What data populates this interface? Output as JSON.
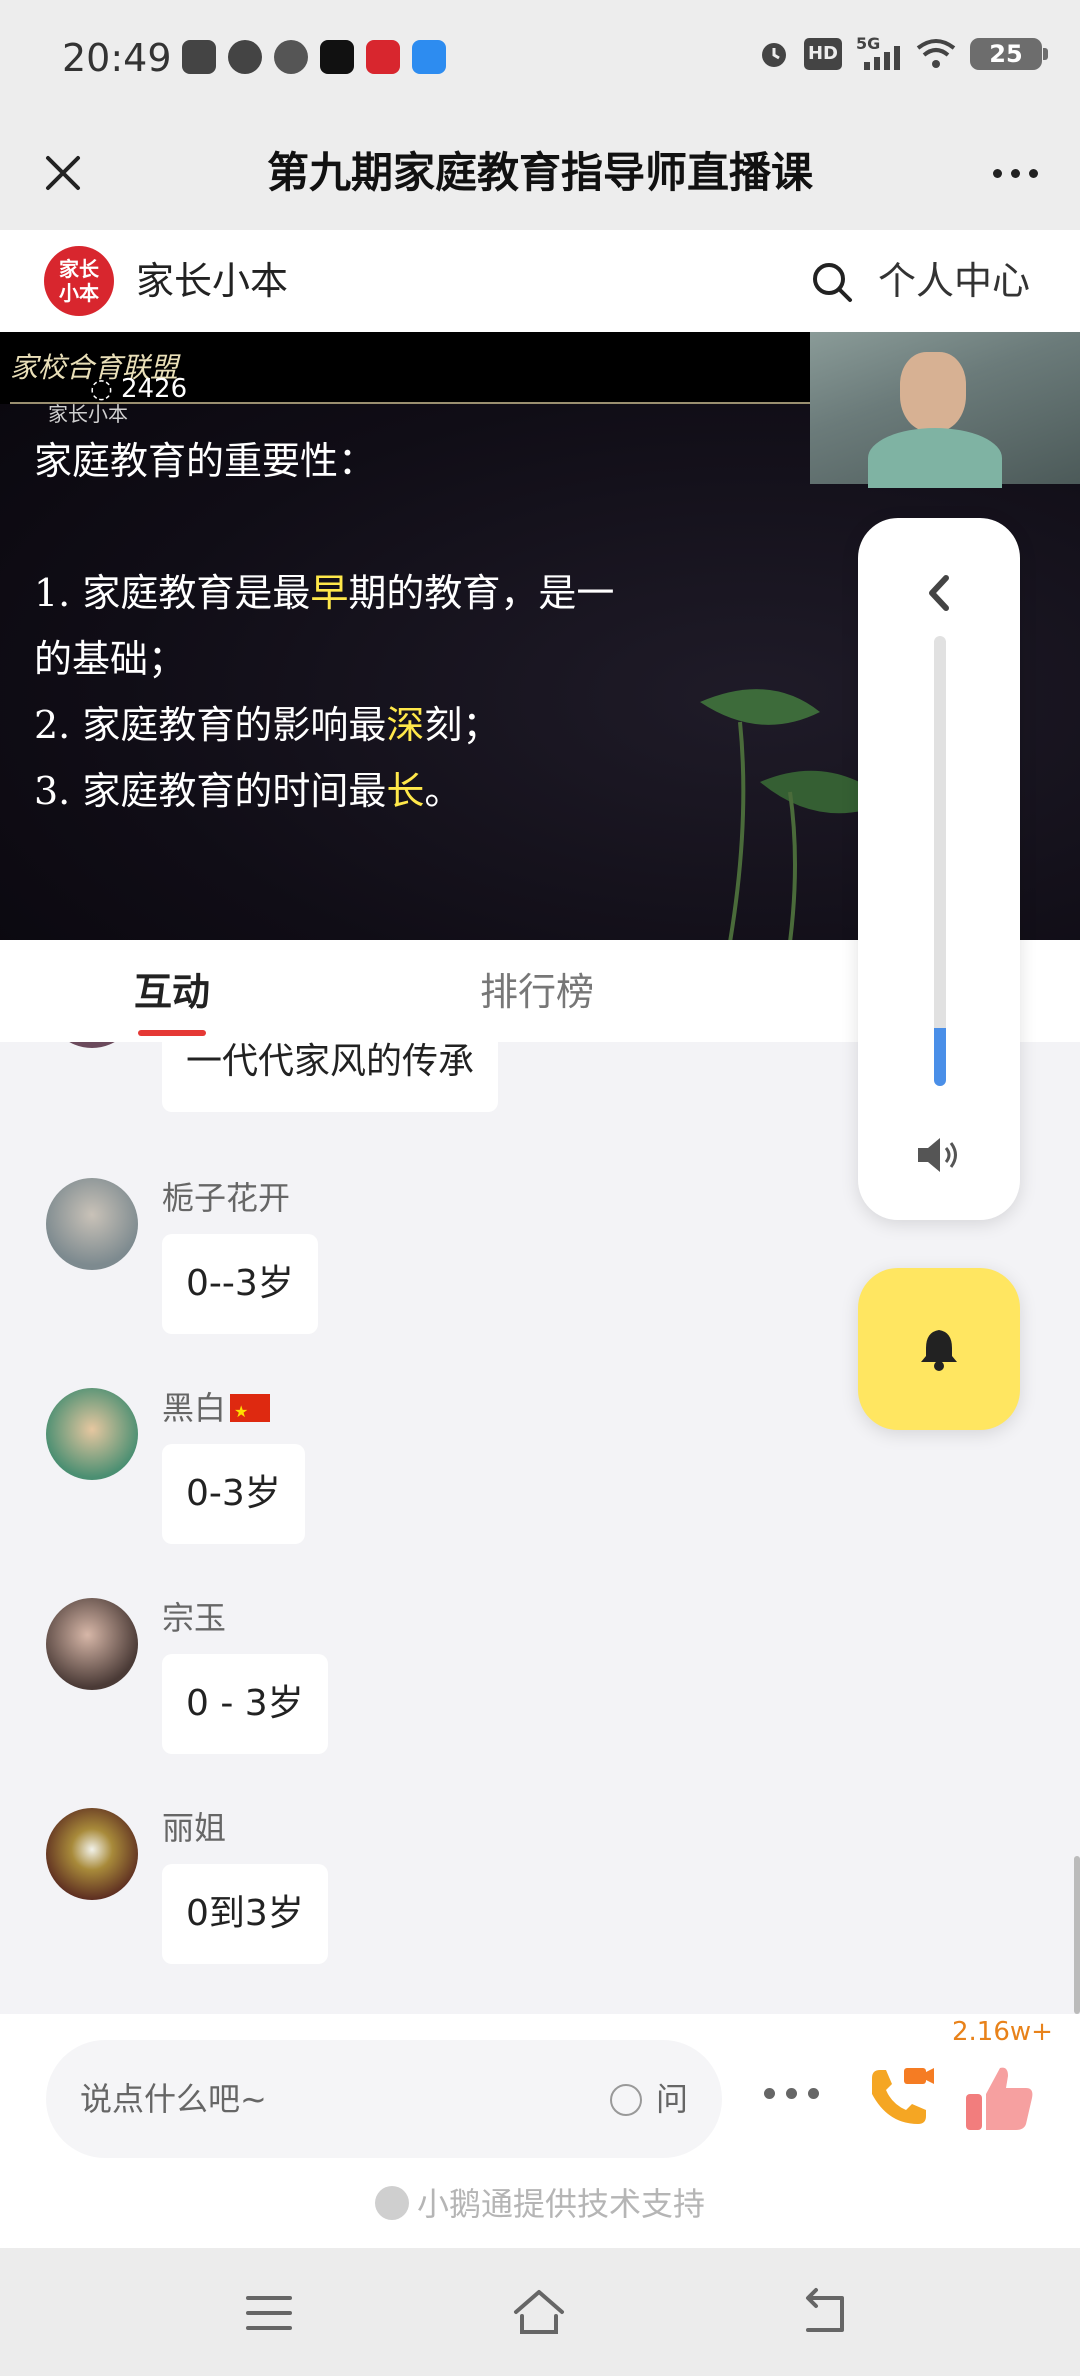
{
  "status": {
    "time": "20:49",
    "network": "5G",
    "hd": "HD",
    "battery": "25"
  },
  "title_bar": {
    "title": "第九期家庭教育指导师直播课"
  },
  "header": {
    "logo_text_1": "家长",
    "logo_text_2": "小本",
    "brand": "家长小本",
    "personal_center": "个人中心"
  },
  "video": {
    "watermark": "家校合育联盟",
    "viewers": "2426",
    "watermark_small": "家长小本",
    "slide": {
      "heading": "家庭教育的重要性：",
      "line1_a": "1. 家庭教育是最",
      "line1_hl": "早",
      "line1_b": "期的教育，是一",
      "line1_c": "的基础；",
      "line2_a": "2. 家庭教育的影响最",
      "line2_hl": "深",
      "line2_b": "刻；",
      "line3_a": "3. 家庭教育的时间最",
      "line3_hl": "长",
      "line3_b": "。"
    }
  },
  "tabs": [
    {
      "label": "互动",
      "active": true
    },
    {
      "label": "排行榜",
      "active": false
    }
  ],
  "messages": [
    {
      "name": "",
      "text": "一代代家风的传承",
      "avatar_color": "#6b4a5c"
    },
    {
      "name": "栀子花开",
      "text": "0--3岁",
      "avatar_color": "#7d8a8f"
    },
    {
      "name": "黑白",
      "text": "0-3岁",
      "avatar_color": "#4b8f72"
    },
    {
      "name": "宗玉",
      "text": "0 - 3岁",
      "avatar_color": "#4a3a36"
    },
    {
      "name": "丽姐",
      "text": "0到3岁",
      "avatar_color": "#5a2a20"
    }
  ],
  "volume": {
    "level": 0.13
  },
  "input": {
    "placeholder": "说点什么吧~",
    "ask_label": "问"
  },
  "likes": {
    "count": "2.16w+"
  },
  "support": {
    "text": "小鹅通提供技术支持"
  },
  "colors": {
    "accent_red": "#e53935",
    "volume_blue": "#4a8fe8",
    "bell_yellow": "#ffe661",
    "like_orange": "#e8821a"
  }
}
